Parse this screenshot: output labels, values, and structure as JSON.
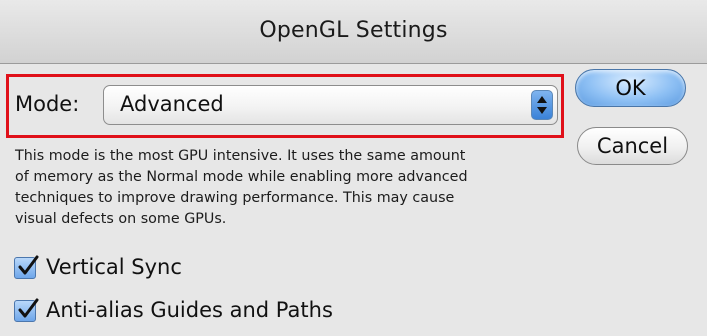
{
  "window": {
    "title": "OpenGL Settings"
  },
  "mode": {
    "label": "Mode:",
    "selected": "Advanced"
  },
  "description": {
    "lines": [
      "This mode is the most GPU intensive.  It uses the same amount",
      "of memory as the Normal mode while enabling more advanced",
      "techniques to improve drawing performance.  This may cause",
      "visual defects on some GPUs."
    ]
  },
  "options": [
    {
      "label": "Vertical Sync",
      "checked": true
    },
    {
      "label": "Anti-alias Guides and Paths",
      "checked": true
    }
  ],
  "buttons": {
    "ok": "OK",
    "cancel": "Cancel"
  },
  "colors": {
    "highlight": "#e0101a",
    "accent": "#3a82d8"
  }
}
